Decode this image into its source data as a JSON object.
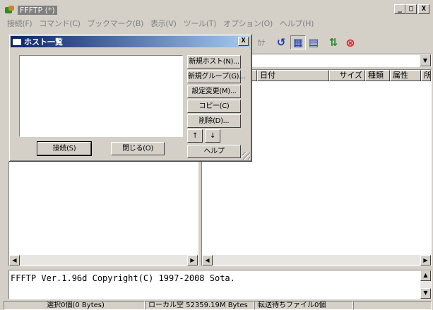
{
  "app": {
    "title": "FFFTP (*)",
    "caption_minimize": "_",
    "caption_maximize": "□",
    "caption_close": "X"
  },
  "menu": [
    "接続(F)",
    "コマンド(C)",
    "ブックマーク(B)",
    "表示(V)",
    "ツール(T)",
    "オプション(O)",
    "ヘルプ(H)"
  ],
  "toolbar": {
    "kana_label": "ｶﾅ",
    "refresh_icon": "↺",
    "list_icon": "▦",
    "detail_icon": "▤",
    "sync_icon": "⇅",
    "stop_icon": "⊗"
  },
  "remote": {
    "columns": [
      "",
      "日付",
      "サイズ",
      "種類",
      "属性",
      "所"
    ]
  },
  "log": {
    "text": "FFFTP Ver.1.96d Copyright(C) 1997-2008 Sota."
  },
  "status": {
    "selected": "選択0個(0 Bytes)",
    "local_free": "ローカル空 52359.19M Bytes",
    "pending": "転送待ちファイル0個"
  },
  "host_dialog": {
    "title": "ホスト一覧",
    "close": "X",
    "buttons": {
      "new_host": "新規ホスト(N)...",
      "new_group": "新規グループ(G)...",
      "settings_change": "設定変更(M)...",
      "copy": "コピー(C)",
      "delete": "削除(D)...",
      "up": "↑",
      "down": "↓",
      "help": "ヘルプ",
      "connect": "接続(S)",
      "close_dialog": "閉じる(O)"
    }
  },
  "scroll": {
    "left_arrow": "◀",
    "right_arrow": "▶",
    "up_arrow": "▲",
    "down_arrow": "▼",
    "dropdown_arrow": "▼"
  },
  "colors": {
    "face": "#d4d0c8",
    "dialog_title_start": "#0a246a",
    "dialog_title_end": "#a6caf0",
    "stop_red": "#d62020",
    "refresh_blue": "#1a3bb0",
    "sync_green": "#2c8a2c"
  }
}
